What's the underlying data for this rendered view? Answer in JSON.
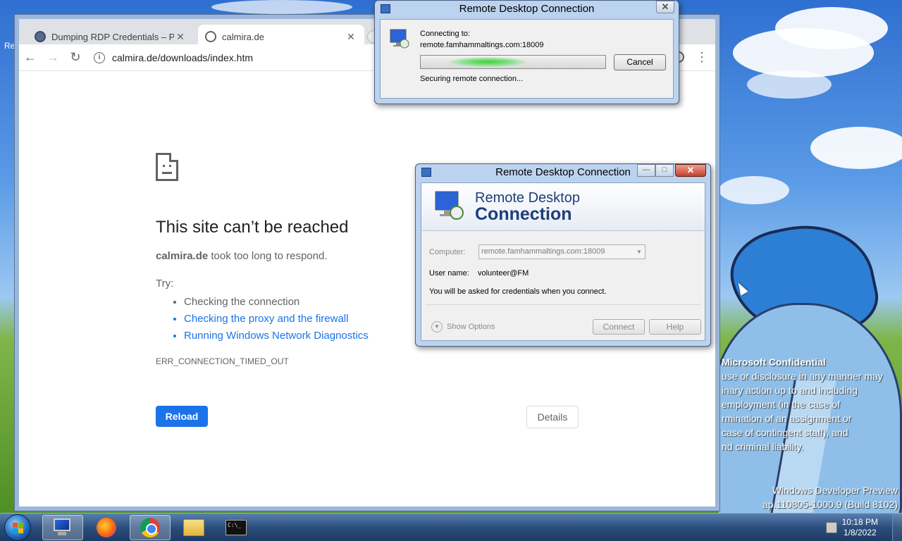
{
  "chrome": {
    "tabs": [
      {
        "title": "Dumping RDP Credentials – Peng",
        "close": "✕"
      },
      {
        "title": "calmira.de",
        "close": "✕"
      }
    ],
    "url": "calmira.de/downloads/index.htm",
    "error": {
      "title": "This site can’t be reached",
      "host": "calmira.de",
      "message": " took too long to respond.",
      "try_label": "Try:",
      "suggestions": [
        "Checking the connection",
        "Checking the proxy and the firewall",
        "Running Windows Network Diagnostics"
      ],
      "code": "ERR_CONNECTION_TIMED_OUT",
      "reload_label": "Reload",
      "details_label": "Details"
    }
  },
  "connecting_dialog": {
    "title": "Remote Desktop Connection",
    "connecting_to_label": "Connecting to:",
    "address": "remote.famhammaltings.com:18009",
    "cancel_label": "Cancel",
    "status": "Securing remote connection..."
  },
  "rdp_dialog": {
    "title": "Remote Desktop Connection",
    "header_line1": "Remote Desktop",
    "header_line2": "Connection",
    "computer_label": "Computer:",
    "computer_value": "remote.famhammaltings.com:18009",
    "username_label": "User name:",
    "username_value": "volunteer@FM",
    "info": "You will be asked for credentials when you connect.",
    "show_options_label": "Show Options",
    "connect_label": "Connect",
    "help_label": "Help",
    "close_label": "✕",
    "minimize_label": "—",
    "maximize_label": "□"
  },
  "desktop": {
    "left_label": "Re",
    "confidential_heading": "Microsoft Confidential",
    "confidential_lines": [
      "use or disclosure in any manner may",
      "inary action up to and including",
      "employment (in the case of",
      "rmination of an assignment or",
      "case of contingent staff), and",
      "nd criminal liability."
    ],
    "watermark_line1": "Windows Developer Preview",
    "watermark_line2": "ap.110805-1000.9 (Build 8102)"
  },
  "taskbar": {
    "time": "10:18 PM",
    "date": "1/8/2022",
    "cmd_text": "C:\\_"
  }
}
